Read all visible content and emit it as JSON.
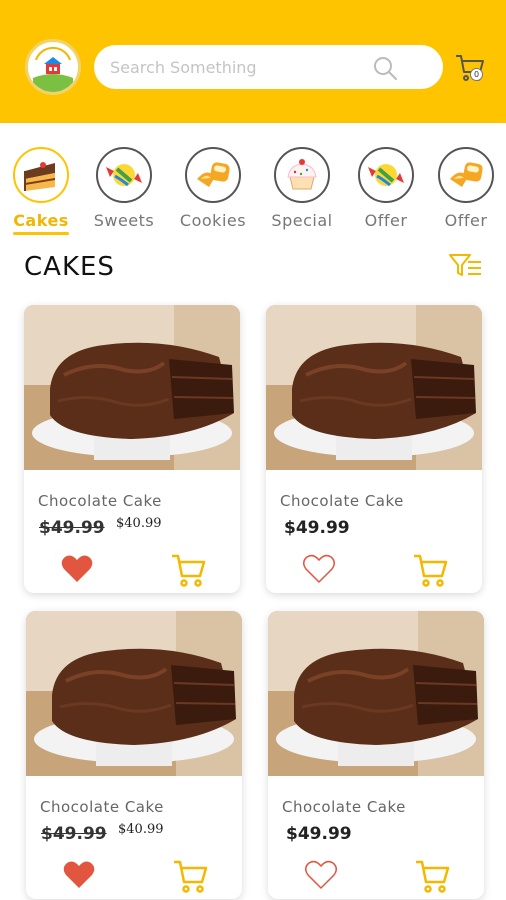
{
  "search": {
    "placeholder": "Search Something"
  },
  "cart": {
    "count": "0"
  },
  "categories": [
    {
      "label": "Cakes",
      "icon": "cake-slice-icon",
      "active": true
    },
    {
      "label": "Sweets",
      "icon": "candy-icon",
      "active": false
    },
    {
      "label": "Cookies",
      "icon": "cookies-icon",
      "active": false
    },
    {
      "label": "Special",
      "icon": "cupcake-icon",
      "active": false
    },
    {
      "label": "Offer",
      "icon": "candy-icon",
      "active": false
    },
    {
      "label": "Offer",
      "icon": "cookies-icon",
      "active": false
    }
  ],
  "section": {
    "title": "CAKES"
  },
  "products": [
    {
      "name": "Chocolate Cake",
      "price_old": "$49.99",
      "price_new": "$40.99",
      "favorite": true
    },
    {
      "name": "Chocolate Cake",
      "price": "$49.99",
      "favorite": false
    },
    {
      "name": "Chocolate Cake",
      "price_old": "$49.99",
      "price_new": "$40.99",
      "favorite": true
    },
    {
      "name": "Chocolate Cake",
      "price": "$49.99",
      "favorite": false
    }
  ],
  "colors": {
    "accent": "#FFC400",
    "heart": "#E2553F",
    "cart": "#F5B800"
  }
}
